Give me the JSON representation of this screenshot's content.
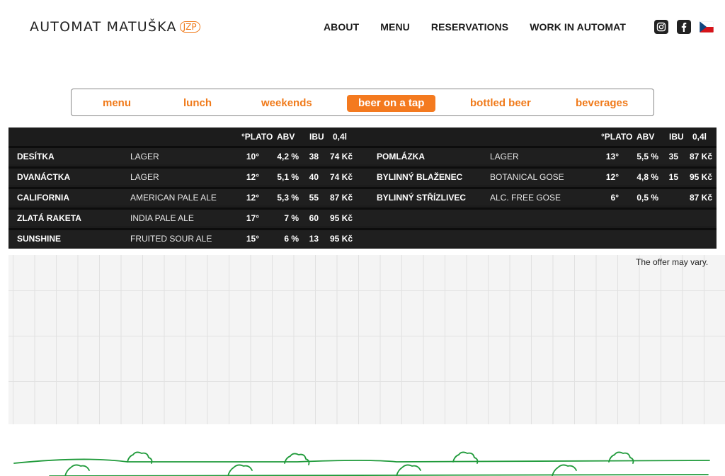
{
  "logo": {
    "text": "AUTOMAT MATUŠKA",
    "badge": "JZP"
  },
  "nav": {
    "items": [
      "ABOUT",
      "MENU",
      "RESERVATIONS",
      "WORK IN AUTOMAT"
    ]
  },
  "social": {
    "icons": [
      "instagram-icon",
      "facebook-icon",
      "czech-flag-icon"
    ]
  },
  "tabs": [
    "menu",
    "lunch",
    "weekends",
    "beer on a tap",
    "bottled beer",
    "beverages"
  ],
  "active_tab": "beer on a tap",
  "table": {
    "headers": {
      "plato": "°PLATO",
      "abv": "ABV",
      "ibu": "IBU",
      "price": "0,4l"
    },
    "left": [
      {
        "name": "DESÍTKA",
        "style": "LAGER",
        "plato": "10°",
        "abv": "4,2 %",
        "ibu": "38",
        "price": "74 Kč"
      },
      {
        "name": "DVANÁCTKA",
        "style": "LAGER",
        "plato": "12°",
        "abv": "5,1 %",
        "ibu": "40",
        "price": "74 Kč"
      },
      {
        "name": "CALIFORNIA",
        "style": "AMERICAN PALE ALE",
        "plato": "12°",
        "abv": "5,3 %",
        "ibu": "55",
        "price": "87 Kč"
      },
      {
        "name": "ZLATÁ RAKETA",
        "style": "INDIA PALE ALE",
        "plato": "17°",
        "abv": "7 %",
        "ibu": "60",
        "price": "95 Kč"
      },
      {
        "name": "SUNSHINE",
        "style": "FRUITED SOUR ALE",
        "plato": "15°",
        "abv": "6 %",
        "ibu": "13",
        "price": "95 Kč"
      }
    ],
    "right": [
      {
        "name": "POMLÁZKA",
        "style": "LAGER",
        "plato": "13°",
        "abv": "5,5 %",
        "ibu": "35",
        "price": "87 Kč"
      },
      {
        "name": "BYLINNÝ BLAŽENEC",
        "style": "BOTANICAL GOSE",
        "plato": "12°",
        "abv": "4,8 %",
        "ibu": "15",
        "price": "95 Kč"
      },
      {
        "name": "BYLINNÝ STŘÍZLIVEC",
        "style": "ALC. FREE GOSE",
        "plato": "6°",
        "abv": "0,5 %",
        "ibu": "",
        "price": "87 Kč"
      }
    ]
  },
  "note": "The offer may vary.",
  "colors": {
    "accent": "#f47a1f",
    "table_bg": "#1c1c1c",
    "deco_green": "#1f9a3a"
  }
}
